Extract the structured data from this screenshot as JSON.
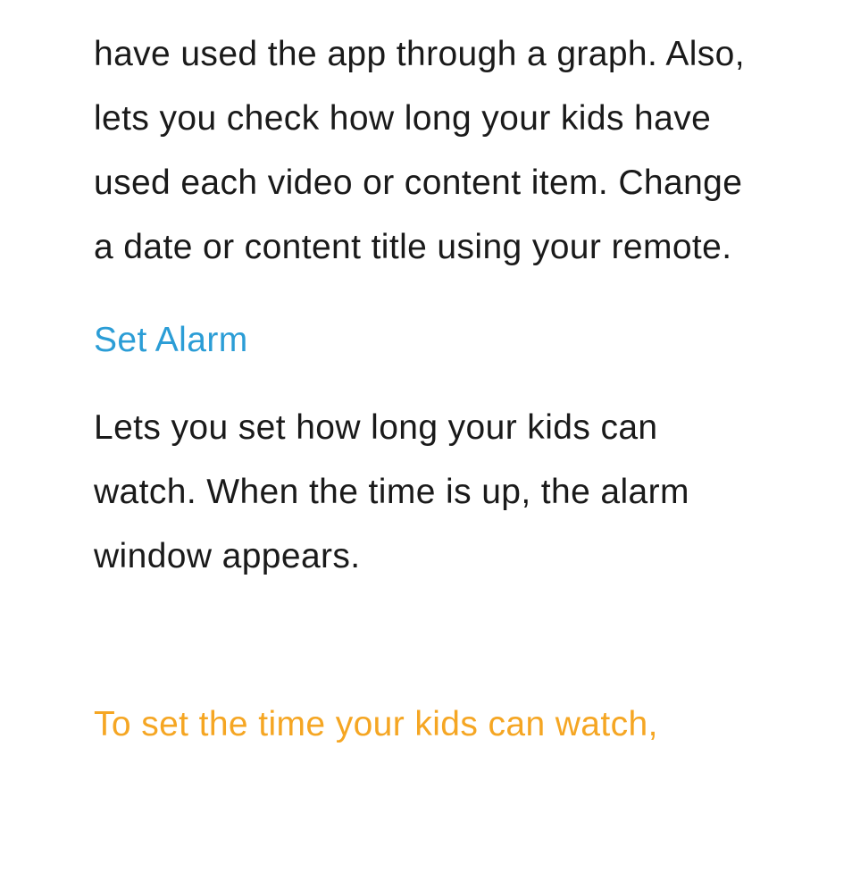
{
  "content": {
    "paragraph1": "have used the app through a graph. Also, lets you check how long your kids have used each video or content item. Change a date or content title using your remote.",
    "heading1": "Set Alarm",
    "paragraph2": "Lets you set how long your kids can watch. When the time is up, the alarm window appears.",
    "heading2": "To set the time your kids can watch,"
  }
}
